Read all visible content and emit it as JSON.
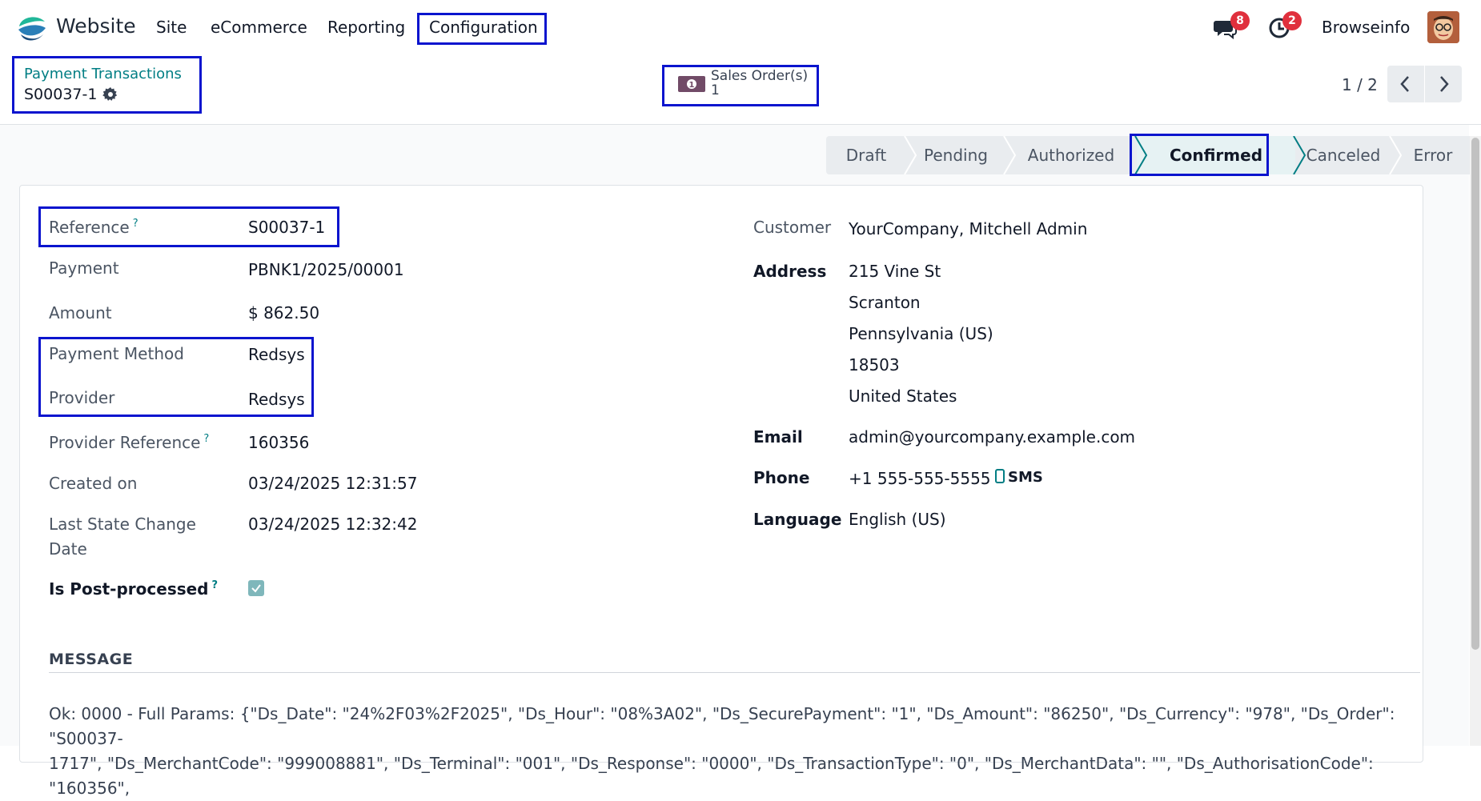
{
  "navbar": {
    "app_name": "Website",
    "menu": [
      "Site",
      "eCommerce",
      "Reporting",
      "Configuration"
    ],
    "messages_count": "8",
    "activities_count": "2",
    "company": "Browseinfo"
  },
  "control_panel": {
    "breadcrumb": "Payment Transactions",
    "record_title": "S00037-1",
    "smart_button": {
      "label": "Sales Order(s)",
      "count": "1"
    },
    "pager": "1 / 2"
  },
  "statusbar": {
    "stages": [
      "Draft",
      "Pending",
      "Authorized",
      "Confirmed",
      "Canceled",
      "Error"
    ],
    "active": "Confirmed"
  },
  "form": {
    "left": {
      "reference": {
        "label": "Reference",
        "help": "?",
        "value": "S00037-1"
      },
      "payment": {
        "label": "Payment",
        "value": "PBNK1/2025/00001"
      },
      "amount": {
        "label": "Amount",
        "value": "$ 862.50"
      },
      "payment_method": {
        "label": "Payment Method",
        "value": "Redsys"
      },
      "provider": {
        "label": "Provider",
        "value": "Redsys"
      },
      "provider_reference": {
        "label": "Provider Reference",
        "help": "?",
        "value": "160356"
      },
      "created_on": {
        "label": "Created on",
        "value": "03/24/2025 12:31:57"
      },
      "last_state_change": {
        "label_line1": "Last State Change",
        "label_line2": "Date",
        "value": "03/24/2025 12:32:42"
      },
      "is_post_processed": {
        "label": "Is Post-processed",
        "help": "?",
        "checked": true
      }
    },
    "right": {
      "customer": {
        "label": "Customer",
        "value": "YourCompany, Mitchell Admin"
      },
      "address": {
        "label": "Address",
        "lines": [
          "215 Vine St",
          "Scranton",
          "Pennsylvania (US)",
          "18503",
          "United States"
        ]
      },
      "email": {
        "label": "Email",
        "value": "admin@yourcompany.example.com"
      },
      "phone": {
        "label": "Phone",
        "value": "+1 555-555-5555",
        "sms": "SMS"
      },
      "language": {
        "label": "Language",
        "value": "English (US)"
      }
    }
  },
  "message": {
    "title": "MESSAGE",
    "line1": "Ok: 0000 - Full Params: {\"Ds_Date\": \"24%2F03%2F2025\", \"Ds_Hour\": \"08%3A02\", \"Ds_SecurePayment\": \"1\", \"Ds_Amount\": \"86250\", \"Ds_Currency\": \"978\", \"Ds_Order\": \"S00037-",
    "line2": "1717\", \"Ds_MerchantCode\": \"999008881\", \"Ds_Terminal\": \"001\", \"Ds_Response\": \"0000\", \"Ds_TransactionType\": \"0\", \"Ds_MerchantData\": \"\", \"Ds_AuthorisationCode\": \"160356\","
  },
  "colors": {
    "accent": "#017e84",
    "highlight_box": "#0a14ce",
    "badge": "#e0303d"
  }
}
